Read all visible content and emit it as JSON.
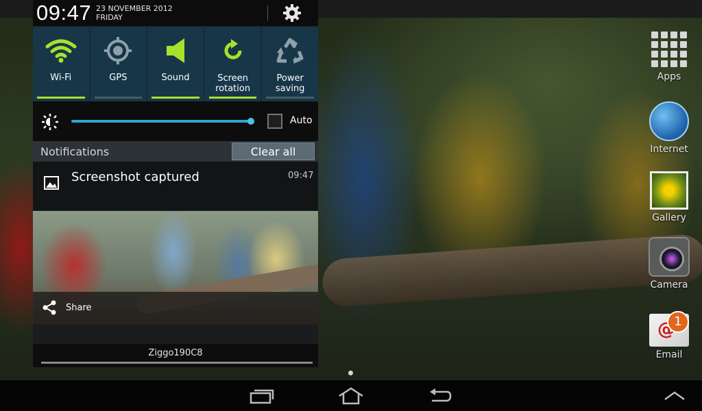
{
  "status_bar": {
    "time": "09:47",
    "date": "23 NOVEMBER 2012",
    "day": "FRIDAY",
    "settings_icon": "gear-icon"
  },
  "quick_toggles": [
    {
      "label": "Wi-Fi",
      "icon": "wifi-icon",
      "on": true
    },
    {
      "label": "GPS",
      "icon": "gps-icon",
      "on": false
    },
    {
      "label": "Sound",
      "icon": "sound-icon",
      "on": true
    },
    {
      "label": "Screen\nrotation",
      "label_line1": "Screen",
      "label_line2": "rotation",
      "icon": "rotation-icon",
      "on": true
    },
    {
      "label_line1": "Power",
      "label_line2": "saving",
      "icon": "recycle-icon",
      "on": false
    }
  ],
  "brightness": {
    "level": 0.98,
    "auto_label": "Auto",
    "auto_checked": false
  },
  "notifications": {
    "header": "Notifications",
    "clear_all": "Clear all",
    "items": [
      {
        "title": "Screenshot captured",
        "time": "09:47",
        "action": "Share"
      }
    ]
  },
  "carrier": "Ziggo190C8",
  "home_shortcuts": [
    {
      "label": "Apps",
      "icon": "apps-grid-icon"
    },
    {
      "label": "Internet",
      "icon": "globe-icon"
    },
    {
      "label": "Gallery",
      "icon": "gallery-icon"
    },
    {
      "label": "Camera",
      "icon": "camera-icon"
    },
    {
      "label": "Email",
      "icon": "email-icon",
      "badge": "1"
    }
  ],
  "colors": {
    "toggle_on": "#a8e12c",
    "accent": "#2fa7d6",
    "toggle_bg": "#173749"
  }
}
